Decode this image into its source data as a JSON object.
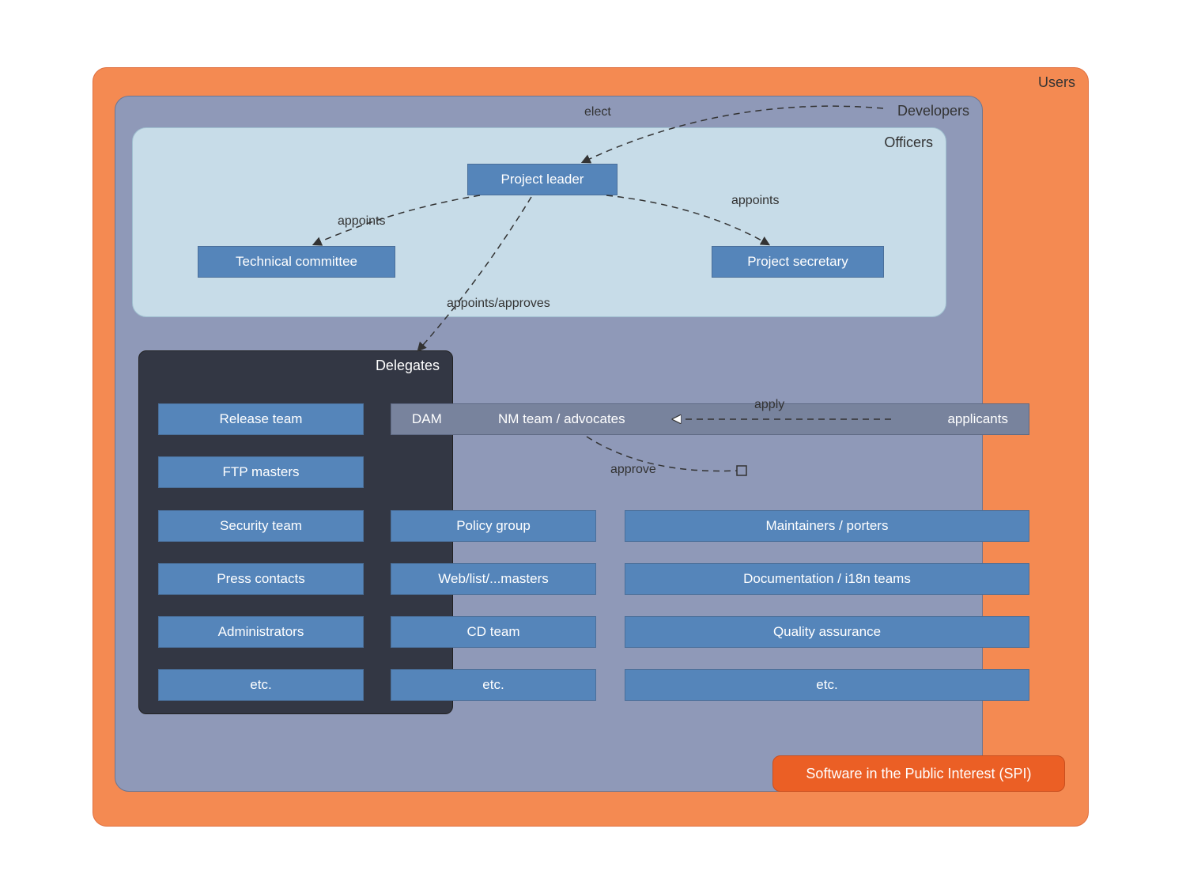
{
  "containers": {
    "users": "Users",
    "developers": "Developers",
    "officers": "Officers",
    "delegates": "Delegates"
  },
  "officers_boxes": {
    "project_leader": "Project leader",
    "technical_committee": "Technical committee",
    "project_secretary": "Project secretary"
  },
  "delegates_col": [
    "Release team",
    "FTP masters",
    "Security team",
    "Press contacts",
    "Administrators",
    "etc."
  ],
  "middle_col": [
    "Policy group",
    "Web/list/...masters",
    "CD team",
    "etc."
  ],
  "right_col": [
    "Maintainers / porters",
    "Documentation / i18n teams",
    "Quality assurance",
    "etc."
  ],
  "graybar": {
    "dam": "DAM",
    "nm": "NM team / advocates",
    "applicants": "applicants"
  },
  "edges": {
    "elect": "elect",
    "appoints_left": "appoints",
    "appoints_right": "appoints",
    "appoints_approves": "appoints/approves",
    "apply": "apply",
    "approve": "approve"
  },
  "spi": "Software in the Public Interest (SPI)",
  "colors": {
    "orange": "#f48a52",
    "blue_container": "#8f99b8",
    "light_blue": "#c7dce8",
    "dark": "#333744",
    "box_blue": "#5585ba",
    "spi_orange": "#eb5f25",
    "gray_blue": "#78839d"
  }
}
